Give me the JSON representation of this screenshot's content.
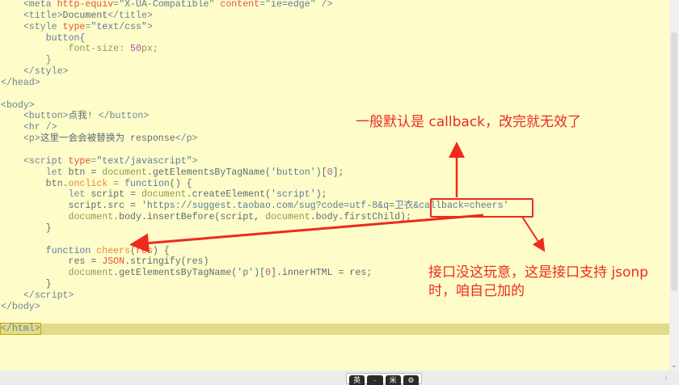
{
  "code_lines": [
    [
      [
        "    ",
        ""
      ],
      [
        "<meta ",
        "tag"
      ],
      [
        "http-equiv",
        "attr"
      ],
      [
        "=",
        "kw"
      ],
      [
        "\"X-UA-Compatible\"",
        "str"
      ],
      [
        " ",
        ""
      ],
      [
        "content",
        "attr"
      ],
      [
        "=",
        "kw"
      ],
      [
        "\"ie=edge\"",
        "str"
      ],
      [
        " />",
        "tag"
      ]
    ],
    [
      [
        "    ",
        ""
      ],
      [
        "<title>",
        "tag"
      ],
      [
        "Document",
        "txt"
      ],
      [
        "</title>",
        "tag"
      ]
    ],
    [
      [
        "    ",
        ""
      ],
      [
        "<style ",
        "tag"
      ],
      [
        "type",
        "attr"
      ],
      [
        "=",
        "kw"
      ],
      [
        "\"text/css\"",
        "str"
      ],
      [
        ">",
        "tag"
      ]
    ],
    [
      [
        "        ",
        ""
      ],
      [
        "button{",
        "fn"
      ]
    ],
    [
      [
        "            ",
        ""
      ],
      [
        "font-size: ",
        "obj"
      ],
      [
        "50",
        "num"
      ],
      [
        "px;",
        "obj"
      ]
    ],
    [
      [
        "        ",
        ""
      ],
      [
        "}",
        "kw"
      ]
    ],
    [
      [
        "    ",
        ""
      ],
      [
        "</style>",
        "tag"
      ]
    ],
    [
      [
        "</head>",
        "tag"
      ]
    ],
    [
      [
        "",
        ""
      ]
    ],
    [
      [
        "<body>",
        "tag"
      ]
    ],
    [
      [
        "    ",
        ""
      ],
      [
        "<button>",
        "tag"
      ],
      [
        "点我! ",
        "txt"
      ],
      [
        "</button>",
        "tag"
      ]
    ],
    [
      [
        "    ",
        ""
      ],
      [
        "<hr />",
        "tag"
      ]
    ],
    [
      [
        "    ",
        ""
      ],
      [
        "<p>",
        "tag"
      ],
      [
        "这里一会会被替换为 response",
        "txt"
      ],
      [
        "</p>",
        "tag"
      ]
    ],
    [
      [
        "",
        ""
      ]
    ],
    [
      [
        "    ",
        ""
      ],
      [
        "<script ",
        "tag"
      ],
      [
        "type",
        "attr"
      ],
      [
        "=",
        "kw"
      ],
      [
        "\"text/javascript\"",
        "str"
      ],
      [
        ">",
        "tag"
      ]
    ],
    [
      [
        "        ",
        ""
      ],
      [
        "let ",
        "kw"
      ],
      [
        "btn = ",
        "txt"
      ],
      [
        "document",
        "obj"
      ],
      [
        ".getElementsByTagName(",
        "txt"
      ],
      [
        "'button'",
        "str"
      ],
      [
        ")[",
        "txt"
      ],
      [
        "0",
        "num"
      ],
      [
        "];",
        "txt"
      ]
    ],
    [
      [
        "        ",
        ""
      ],
      [
        "btn.",
        "txt"
      ],
      [
        "onclick",
        "prop"
      ],
      [
        " = ",
        "kw"
      ],
      [
        "function",
        "fn"
      ],
      [
        "() {",
        "txt"
      ]
    ],
    [
      [
        "            ",
        ""
      ],
      [
        "let ",
        "kw"
      ],
      [
        "script = ",
        "txt"
      ],
      [
        "document",
        "obj"
      ],
      [
        ".createElement(",
        "txt"
      ],
      [
        "'script'",
        "str"
      ],
      [
        ");",
        "txt"
      ]
    ],
    [
      [
        "            ",
        ""
      ],
      [
        "script.src = ",
        "txt"
      ],
      [
        "'https://suggest.taobao.com/sug?code=utf-8&q=卫衣&callback=cheers'",
        "str"
      ]
    ],
    [
      [
        "            ",
        ""
      ],
      [
        "document",
        "obj"
      ],
      [
        ".body.insertBefore(script, ",
        "txt"
      ],
      [
        "document",
        "obj"
      ],
      [
        ".body.firstChild);",
        "txt"
      ]
    ],
    [
      [
        "        ",
        ""
      ],
      [
        "}",
        "txt"
      ]
    ],
    [
      [
        "",
        ""
      ]
    ],
    [
      [
        "        ",
        ""
      ],
      [
        "function ",
        "fn"
      ],
      [
        "cheers",
        "prop"
      ],
      [
        "(",
        "txt"
      ],
      [
        "res",
        "attr"
      ],
      [
        ") {",
        "txt"
      ]
    ],
    [
      [
        "            ",
        ""
      ],
      [
        "res = ",
        "txt"
      ],
      [
        "JSON",
        "attr"
      ],
      [
        ".stringify(res)",
        "txt"
      ]
    ],
    [
      [
        "            ",
        ""
      ],
      [
        "document",
        "obj"
      ],
      [
        ".getElementsByTagName(",
        "txt"
      ],
      [
        "'p'",
        "str"
      ],
      [
        ")[",
        "txt"
      ],
      [
        "0",
        "num"
      ],
      [
        "].innerHTML = res;",
        "txt"
      ]
    ],
    [
      [
        "        ",
        ""
      ],
      [
        "}",
        "txt"
      ]
    ],
    [
      [
        "    ",
        ""
      ],
      [
        "</script>",
        "tag"
      ]
    ],
    [
      [
        "</body>",
        "tag"
      ]
    ],
    [
      [
        "",
        ""
      ]
    ],
    [
      [
        "</html>",
        "cur-tag"
      ]
    ]
  ],
  "annotations": {
    "top_note": "一般默认是 callback，改完就无效了",
    "bottom_note_line1": "接口没这玩意，这是接口支持 jsonp",
    "bottom_note_line2": "时，咱自己加的",
    "color": "#ee2a1c"
  },
  "ime_toolbar": [
    "英",
    "·",
    "米",
    "⚙"
  ]
}
